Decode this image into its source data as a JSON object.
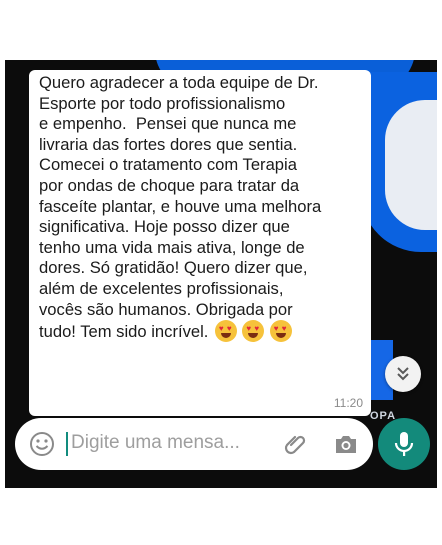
{
  "message": {
    "text": "Quero agradecer a toda equipe de Dr.\nEsporte por todo profissionalismo\ne empenho.  Pensei que nunca me\nlivraria das fortes dores que sentia.\nComecei o tratamento com Terapia\npor ondas de choque para tratar da\nfasceíte plantar, e houve uma melhora\nsignificativa. Hoje posso dizer que\ntenho uma vida mais ativa, longe de\ndores. Só gratidão! Quero dizer que,\nalém de excelentes profissionais,\nvocês são humanos. Obrigada por\ntudo! Tem sido incrível.",
    "emojis": [
      "heart-eyes-emoji",
      "heart-eyes-emoji",
      "heart-eyes-emoji"
    ],
    "time": "11:20"
  },
  "background_text": "OPA",
  "composer": {
    "placeholder": "Digite uma mensa..."
  },
  "colors": {
    "accent": "#138a7b",
    "bubble": "#ffffff",
    "background": "#0c0c0c",
    "brand_blue": "#0b62e0"
  }
}
